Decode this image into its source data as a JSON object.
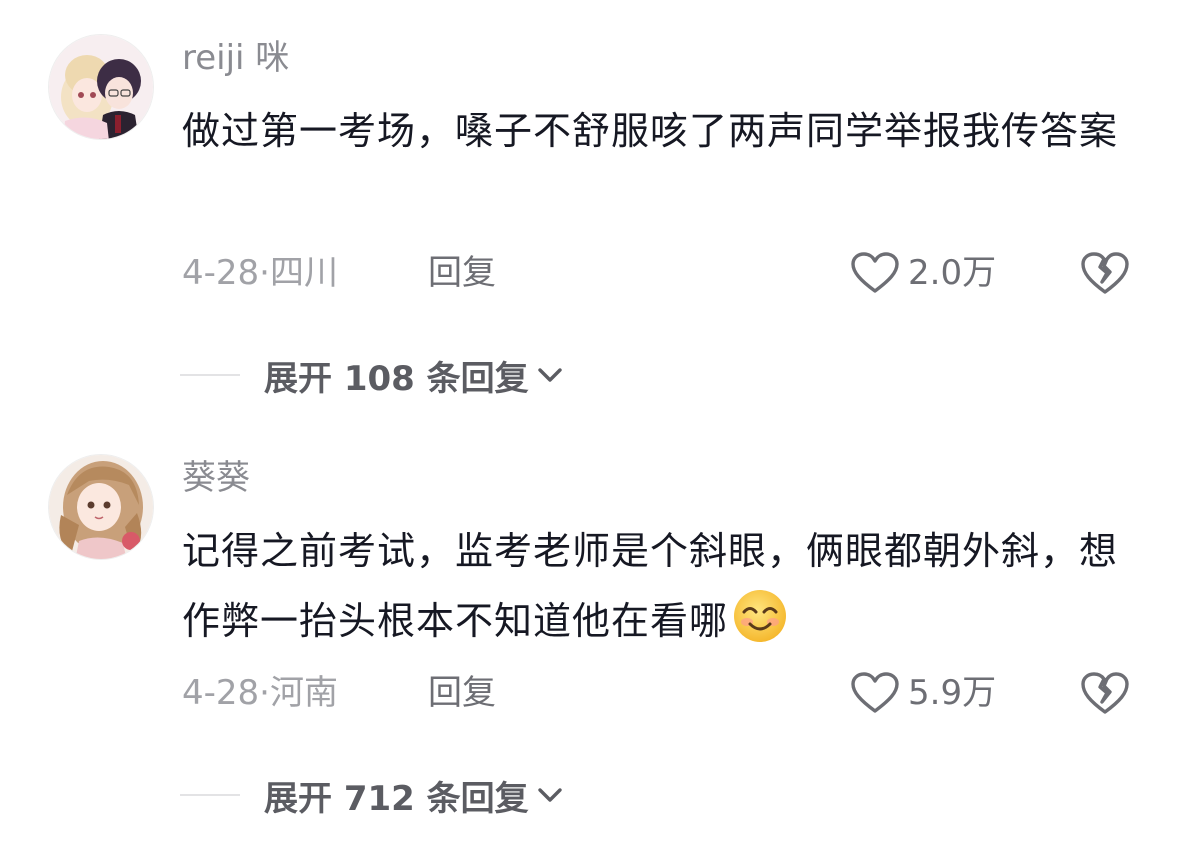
{
  "comments": [
    {
      "username": "reiji 咪",
      "text": "做过第一考场，嗓子不舒服咳了两声同学举报我传答案",
      "emoji": "",
      "date": "4-28",
      "location": "四川",
      "reply_label": "回复",
      "likes": "2.0万",
      "expand_label": "展开 108 条回复"
    },
    {
      "username": "葵葵",
      "text": "记得之前考试，监考老师是个斜眼，俩眼都朝外斜，想作弊一抬头根本不知道他在看哪",
      "emoji": "smile-emoji",
      "date": "4-28",
      "location": "河南",
      "reply_label": "回复",
      "likes": "5.9万",
      "expand_label": "展开 712 条回复"
    }
  ],
  "meta_separator": "·",
  "colors": {
    "text": "#161823",
    "secondary": "#a1a2a7",
    "username": "#8a8b91",
    "action": "#6d6e74"
  }
}
